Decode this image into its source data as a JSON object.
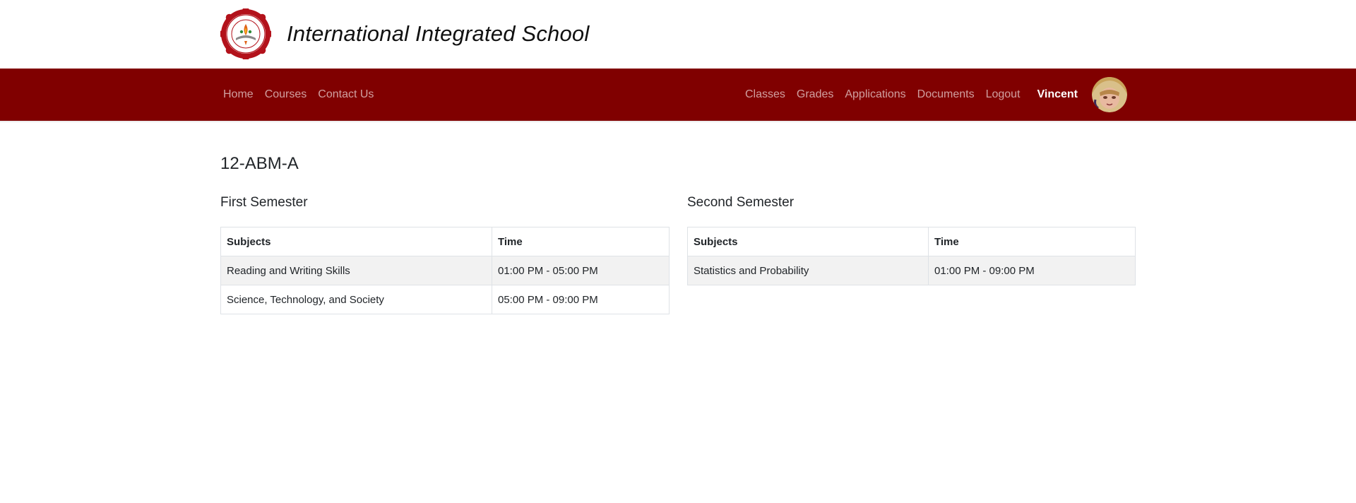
{
  "header": {
    "school_name": "International Integrated School",
    "logo_icon": "school-seal-logo"
  },
  "nav": {
    "left": [
      {
        "label": "Home"
      },
      {
        "label": "Courses"
      },
      {
        "label": "Contact Us"
      }
    ],
    "right": [
      {
        "label": "Classes"
      },
      {
        "label": "Grades"
      },
      {
        "label": "Applications"
      },
      {
        "label": "Documents"
      },
      {
        "label": "Logout"
      }
    ],
    "user_name": "Vincent",
    "avatar_icon": "user-avatar"
  },
  "colors": {
    "brand": "#800000",
    "nav_text": "#c7b2b2",
    "stripe": "#f2f2f2"
  },
  "main": {
    "class_title": "12-ABM-A",
    "first_semester": {
      "title": "First Semester",
      "headers": [
        "Subjects",
        "Time"
      ],
      "rows": [
        {
          "subject": "Reading and Writing Skills",
          "time": "01:00 PM - 05:00 PM"
        },
        {
          "subject": "Science, Technology, and Society",
          "time": "05:00 PM - 09:00 PM"
        }
      ]
    },
    "second_semester": {
      "title": "Second Semester",
      "headers": [
        "Subjects",
        "Time"
      ],
      "rows": [
        {
          "subject": "Statistics and Probability",
          "time": "01:00 PM - 09:00 PM"
        }
      ]
    }
  }
}
